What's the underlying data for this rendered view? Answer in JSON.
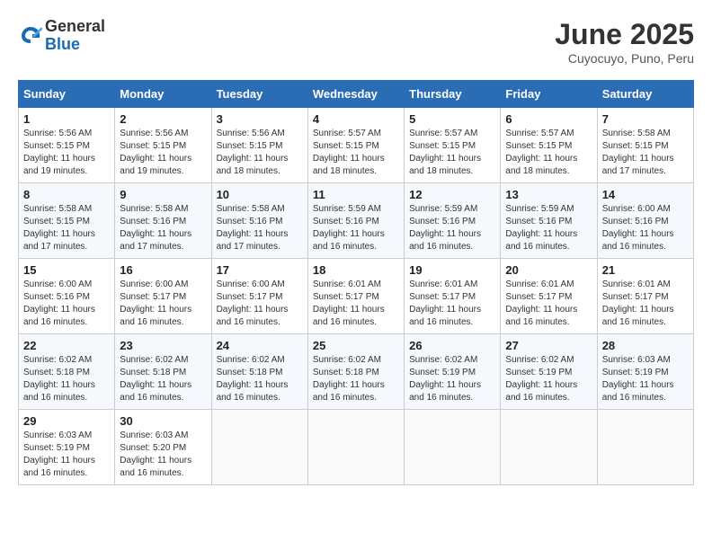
{
  "header": {
    "logo_general": "General",
    "logo_blue": "Blue",
    "title": "June 2025",
    "location": "Cuyocuyo, Puno, Peru"
  },
  "days_of_week": [
    "Sunday",
    "Monday",
    "Tuesday",
    "Wednesday",
    "Thursday",
    "Friday",
    "Saturday"
  ],
  "weeks": [
    [
      {
        "day": "1",
        "info": "Sunrise: 5:56 AM\nSunset: 5:15 PM\nDaylight: 11 hours\nand 19 minutes."
      },
      {
        "day": "2",
        "info": "Sunrise: 5:56 AM\nSunset: 5:15 PM\nDaylight: 11 hours\nand 19 minutes."
      },
      {
        "day": "3",
        "info": "Sunrise: 5:56 AM\nSunset: 5:15 PM\nDaylight: 11 hours\nand 18 minutes."
      },
      {
        "day": "4",
        "info": "Sunrise: 5:57 AM\nSunset: 5:15 PM\nDaylight: 11 hours\nand 18 minutes."
      },
      {
        "day": "5",
        "info": "Sunrise: 5:57 AM\nSunset: 5:15 PM\nDaylight: 11 hours\nand 18 minutes."
      },
      {
        "day": "6",
        "info": "Sunrise: 5:57 AM\nSunset: 5:15 PM\nDaylight: 11 hours\nand 18 minutes."
      },
      {
        "day": "7",
        "info": "Sunrise: 5:58 AM\nSunset: 5:15 PM\nDaylight: 11 hours\nand 17 minutes."
      }
    ],
    [
      {
        "day": "8",
        "info": "Sunrise: 5:58 AM\nSunset: 5:15 PM\nDaylight: 11 hours\nand 17 minutes."
      },
      {
        "day": "9",
        "info": "Sunrise: 5:58 AM\nSunset: 5:16 PM\nDaylight: 11 hours\nand 17 minutes."
      },
      {
        "day": "10",
        "info": "Sunrise: 5:58 AM\nSunset: 5:16 PM\nDaylight: 11 hours\nand 17 minutes."
      },
      {
        "day": "11",
        "info": "Sunrise: 5:59 AM\nSunset: 5:16 PM\nDaylight: 11 hours\nand 16 minutes."
      },
      {
        "day": "12",
        "info": "Sunrise: 5:59 AM\nSunset: 5:16 PM\nDaylight: 11 hours\nand 16 minutes."
      },
      {
        "day": "13",
        "info": "Sunrise: 5:59 AM\nSunset: 5:16 PM\nDaylight: 11 hours\nand 16 minutes."
      },
      {
        "day": "14",
        "info": "Sunrise: 6:00 AM\nSunset: 5:16 PM\nDaylight: 11 hours\nand 16 minutes."
      }
    ],
    [
      {
        "day": "15",
        "info": "Sunrise: 6:00 AM\nSunset: 5:16 PM\nDaylight: 11 hours\nand 16 minutes."
      },
      {
        "day": "16",
        "info": "Sunrise: 6:00 AM\nSunset: 5:17 PM\nDaylight: 11 hours\nand 16 minutes."
      },
      {
        "day": "17",
        "info": "Sunrise: 6:00 AM\nSunset: 5:17 PM\nDaylight: 11 hours\nand 16 minutes."
      },
      {
        "day": "18",
        "info": "Sunrise: 6:01 AM\nSunset: 5:17 PM\nDaylight: 11 hours\nand 16 minutes."
      },
      {
        "day": "19",
        "info": "Sunrise: 6:01 AM\nSunset: 5:17 PM\nDaylight: 11 hours\nand 16 minutes."
      },
      {
        "day": "20",
        "info": "Sunrise: 6:01 AM\nSunset: 5:17 PM\nDaylight: 11 hours\nand 16 minutes."
      },
      {
        "day": "21",
        "info": "Sunrise: 6:01 AM\nSunset: 5:17 PM\nDaylight: 11 hours\nand 16 minutes."
      }
    ],
    [
      {
        "day": "22",
        "info": "Sunrise: 6:02 AM\nSunset: 5:18 PM\nDaylight: 11 hours\nand 16 minutes."
      },
      {
        "day": "23",
        "info": "Sunrise: 6:02 AM\nSunset: 5:18 PM\nDaylight: 11 hours\nand 16 minutes."
      },
      {
        "day": "24",
        "info": "Sunrise: 6:02 AM\nSunset: 5:18 PM\nDaylight: 11 hours\nand 16 minutes."
      },
      {
        "day": "25",
        "info": "Sunrise: 6:02 AM\nSunset: 5:18 PM\nDaylight: 11 hours\nand 16 minutes."
      },
      {
        "day": "26",
        "info": "Sunrise: 6:02 AM\nSunset: 5:19 PM\nDaylight: 11 hours\nand 16 minutes."
      },
      {
        "day": "27",
        "info": "Sunrise: 6:02 AM\nSunset: 5:19 PM\nDaylight: 11 hours\nand 16 minutes."
      },
      {
        "day": "28",
        "info": "Sunrise: 6:03 AM\nSunset: 5:19 PM\nDaylight: 11 hours\nand 16 minutes."
      }
    ],
    [
      {
        "day": "29",
        "info": "Sunrise: 6:03 AM\nSunset: 5:19 PM\nDaylight: 11 hours\nand 16 minutes."
      },
      {
        "day": "30",
        "info": "Sunrise: 6:03 AM\nSunset: 5:20 PM\nDaylight: 11 hours\nand 16 minutes."
      },
      {
        "day": "",
        "info": ""
      },
      {
        "day": "",
        "info": ""
      },
      {
        "day": "",
        "info": ""
      },
      {
        "day": "",
        "info": ""
      },
      {
        "day": "",
        "info": ""
      }
    ]
  ]
}
